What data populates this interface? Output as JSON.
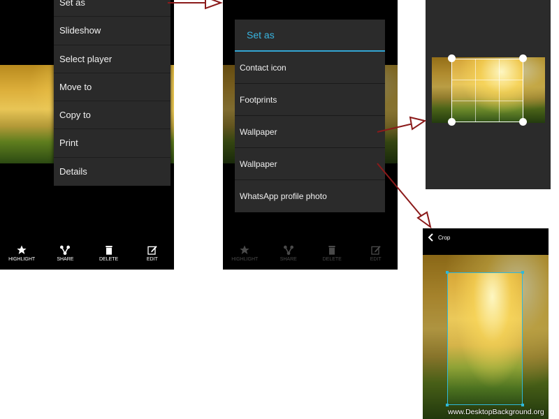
{
  "panel1": {
    "menu": [
      "Set as",
      "Slideshow",
      "Select player",
      "Move to",
      "Copy to",
      "Print",
      "Details"
    ],
    "bottom_bar": [
      {
        "label": "HIGHLIGHT",
        "icon": "star-icon"
      },
      {
        "label": "SHARE",
        "icon": "share-icon"
      },
      {
        "label": "DELETE",
        "icon": "trash-icon"
      },
      {
        "label": "EDIT",
        "icon": "edit-icon"
      }
    ]
  },
  "panel2": {
    "dialog_title": "Set as",
    "options": [
      "Contact icon",
      "Footprints",
      "Wallpaper",
      "Wallpaper",
      "WhatsApp profile photo"
    ],
    "bottom_bar": [
      {
        "label": "HIGHLIGHT",
        "icon": "star-icon"
      },
      {
        "label": "SHARE",
        "icon": "share-icon"
      },
      {
        "label": "DELETE",
        "icon": "trash-icon"
      },
      {
        "label": "EDIT",
        "icon": "edit-icon"
      }
    ]
  },
  "panel4": {
    "title": "Crop",
    "back_icon": "chevron-left-icon"
  },
  "watermark": "www.DesktopBackground.org",
  "colors": {
    "accent": "#33a6d3",
    "arrow": "#8b1a1a",
    "crop_frame": "#2fb8d8"
  }
}
